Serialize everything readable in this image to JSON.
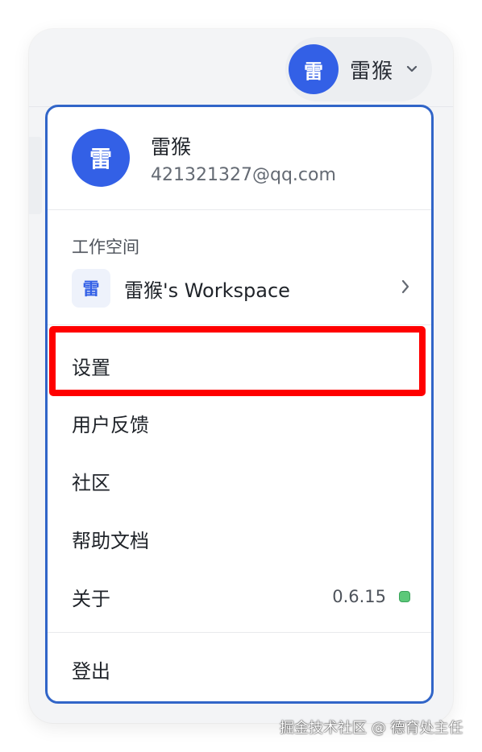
{
  "header": {
    "avatar_initial": "雷",
    "user_name": "雷猴",
    "chevron_icon": "chevron-down-icon"
  },
  "profile": {
    "avatar_initial": "雷",
    "name": "雷猴",
    "email": "421321327@qq.com"
  },
  "workspace": {
    "section_label": "工作空间",
    "icon_initial": "雷",
    "name": "雷猴's Workspace",
    "chevron_icon": "chevron-right-icon"
  },
  "menu": {
    "settings": "设置",
    "feedback": "用户反馈",
    "community": "社区",
    "help_docs": "帮助文档",
    "about": "关于",
    "version": "0.6.15",
    "logout": "登出"
  },
  "watermark": "掘金技术社区 @ 德育处主任",
  "colors": {
    "accent": "#3360e6",
    "menu_border": "#3165c8",
    "highlight": "#ff0000",
    "status_ok": "#5cc879"
  }
}
